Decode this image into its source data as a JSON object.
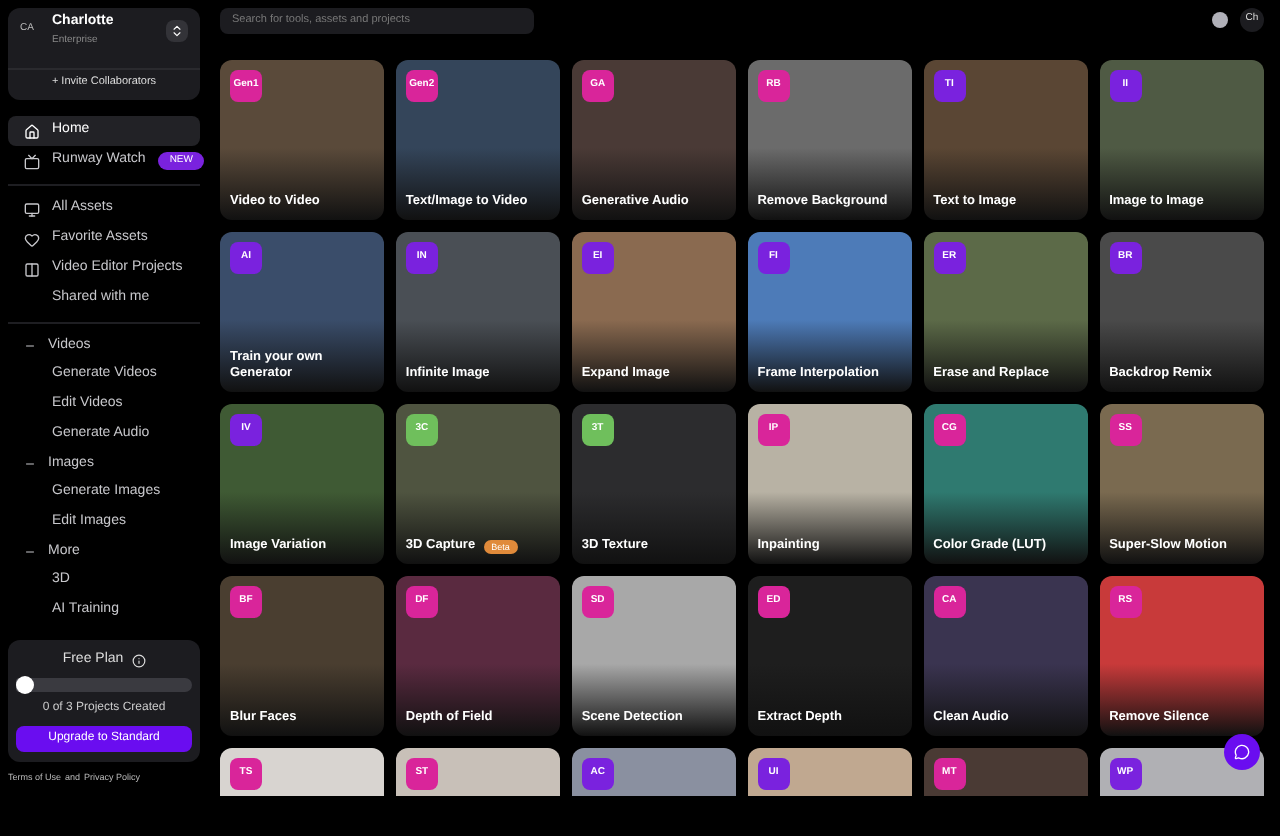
{
  "account": {
    "avatar": "CA",
    "name": "Charlotte",
    "plan": "Enterprise",
    "invite": "+ Invite Collaborators"
  },
  "nav": [
    {
      "label": "Home",
      "selected": true
    },
    {
      "label": "Runway Watch",
      "selected": false,
      "badge": "NEW"
    }
  ],
  "library": [
    {
      "label": "All Assets",
      "selected": false
    },
    {
      "label": "Favorite Assets",
      "selected": false
    },
    {
      "label": "Video Editor Projects",
      "selected": false
    },
    {
      "label": "Shared with me",
      "selected": false
    }
  ],
  "sections": [
    {
      "title": "Videos",
      "expanded": true,
      "items": [
        {
          "label": "Generate Videos",
          "selected": false
        },
        {
          "label": "Edit Videos",
          "selected": false
        },
        {
          "label": "Generate Audio",
          "selected": false
        }
      ]
    },
    {
      "title": "Images",
      "expanded": true,
      "items": [
        {
          "label": "Generate Images",
          "selected": false
        },
        {
          "label": "Edit Images",
          "selected": false
        }
      ]
    },
    {
      "title": "More",
      "expanded": true,
      "items": [
        {
          "label": "3D",
          "selected": false
        },
        {
          "label": "AI Training",
          "selected": false
        }
      ]
    }
  ],
  "plan_card": {
    "title": "Free Plan",
    "level": 0.05,
    "caption": "0 of 3 Projects Created",
    "button": "Upgrade to Standard"
  },
  "footer": {
    "terms": "Terms of Use",
    "and": "and",
    "privacy": "Privacy Policy"
  },
  "search": {
    "placeholder": "Search for tools, assets and projects"
  },
  "user_avatar": "Ch",
  "tiles": [
    {
      "badge": "Gen1",
      "color": "#d9259a",
      "label": "Video to Video"
    },
    {
      "badge": "Gen2",
      "color": "#d9259a",
      "label": "Text/Image to Video"
    },
    {
      "badge": "GA",
      "color": "#d9259a",
      "label": "Generative Audio"
    },
    {
      "badge": "RB",
      "color": "#d9259a",
      "label": "Remove Background"
    },
    {
      "badge": "TI",
      "color": "#7a22de",
      "label": "Text to Image"
    },
    {
      "badge": "II",
      "color": "#7a22de",
      "label": "Image to Image"
    },
    {
      "badge": "AI",
      "color": "#7a22de",
      "label": "Train your own Generator"
    },
    {
      "badge": "IN",
      "color": "#7a22de",
      "label": "Infinite Image"
    },
    {
      "badge": "EI",
      "color": "#7a22de",
      "label": "Expand Image"
    },
    {
      "badge": "FI",
      "color": "#7a22de",
      "label": "Frame Interpolation"
    },
    {
      "badge": "ER",
      "color": "#7a22de",
      "label": "Erase and Replace"
    },
    {
      "badge": "BR",
      "color": "#7a22de",
      "label": "Backdrop Remix"
    },
    {
      "badge": "IV",
      "color": "#7a22de",
      "label": "Image Variation"
    },
    {
      "badge": "3C",
      "color": "#6fbf5c",
      "label": "3D Capture",
      "tag": "Beta"
    },
    {
      "badge": "3T",
      "color": "#6fbf5c",
      "label": "3D Texture"
    },
    {
      "badge": "IP",
      "color": "#d9259a",
      "label": "Inpainting"
    },
    {
      "badge": "CG",
      "color": "#d9259a",
      "label": "Color Grade (LUT)"
    },
    {
      "badge": "SS",
      "color": "#d9259a",
      "label": "Super-Slow Motion"
    },
    {
      "badge": "BF",
      "color": "#d9259a",
      "label": "Blur Faces"
    },
    {
      "badge": "DF",
      "color": "#d9259a",
      "label": "Depth of Field"
    },
    {
      "badge": "SD",
      "color": "#d9259a",
      "label": "Scene Detection"
    },
    {
      "badge": "ED",
      "color": "#d9259a",
      "label": "Extract Depth"
    },
    {
      "badge": "CA",
      "color": "#d9259a",
      "label": "Clean Audio"
    },
    {
      "badge": "RS",
      "color": "#d9259a",
      "label": "Remove Silence"
    },
    {
      "badge": "TS",
      "color": "#d9259a"
    },
    {
      "badge": "ST",
      "color": "#d9259a"
    },
    {
      "badge": "AC",
      "color": "#7a22de"
    },
    {
      "badge": "UI",
      "color": "#7a22de"
    },
    {
      "badge": "MT",
      "color": "#d9259a"
    },
    {
      "badge": "WP",
      "color": "#7a22de"
    }
  ]
}
